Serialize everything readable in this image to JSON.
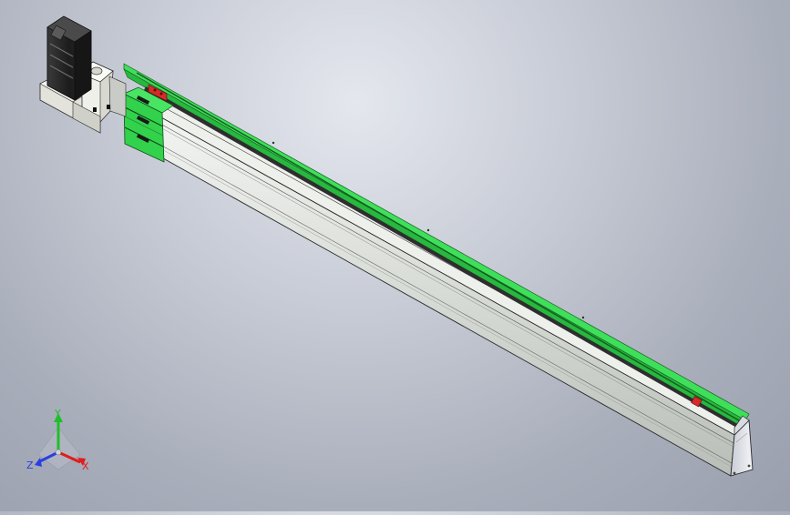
{
  "triad": {
    "axis_x_label": "X",
    "axis_y_label": "Y",
    "axis_z_label": "Z",
    "colors": {
      "x": "#e21b1b",
      "y": "#1fbf2a",
      "z": "#2a3fe0"
    }
  },
  "model_colors": {
    "rail_cover": "#2fd64a",
    "profile_body": "#dde1dd",
    "motor": "#2b2b2b",
    "bracket": "#e8e8e2",
    "end_stop": "#d92a2a",
    "end_cap": "#e6e8ee"
  }
}
